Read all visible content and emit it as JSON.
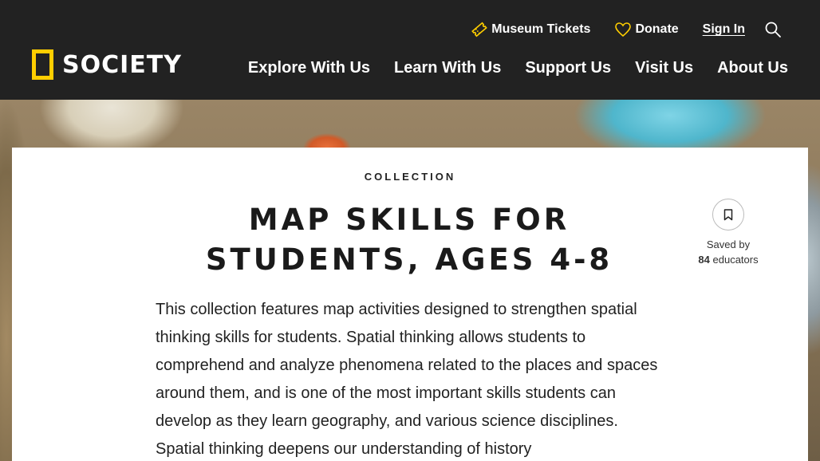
{
  "header": {
    "logo_text": "SOCIETY",
    "utility": {
      "tickets": "Museum Tickets",
      "donate": "Donate",
      "signin": "Sign In"
    },
    "nav": [
      "Explore With Us",
      "Learn With Us",
      "Support Us",
      "Visit Us",
      "About Us"
    ]
  },
  "content": {
    "eyebrow": "COLLECTION",
    "title": "MAP SKILLS FOR STUDENTS, AGES 4-8",
    "saved_prefix": "Saved by",
    "saved_count": "84",
    "saved_suffix": "educators",
    "description": "This collection features map activities designed to strengthen spatial thinking skills for students. Spatial thinking allows students to comprehend and analyze phenomena related to the places and spaces around them, and is one of the most important skills students can develop as they learn geography, and various science disciplines. Spatial thinking deepens our understanding of history"
  },
  "colors": {
    "header_bg": "#222222",
    "logo_yellow": "#ffce00",
    "icon_yellow": "#ffce00"
  },
  "icons": [
    "ticket-icon",
    "heart-icon",
    "search-icon",
    "bookmark-icon"
  ]
}
